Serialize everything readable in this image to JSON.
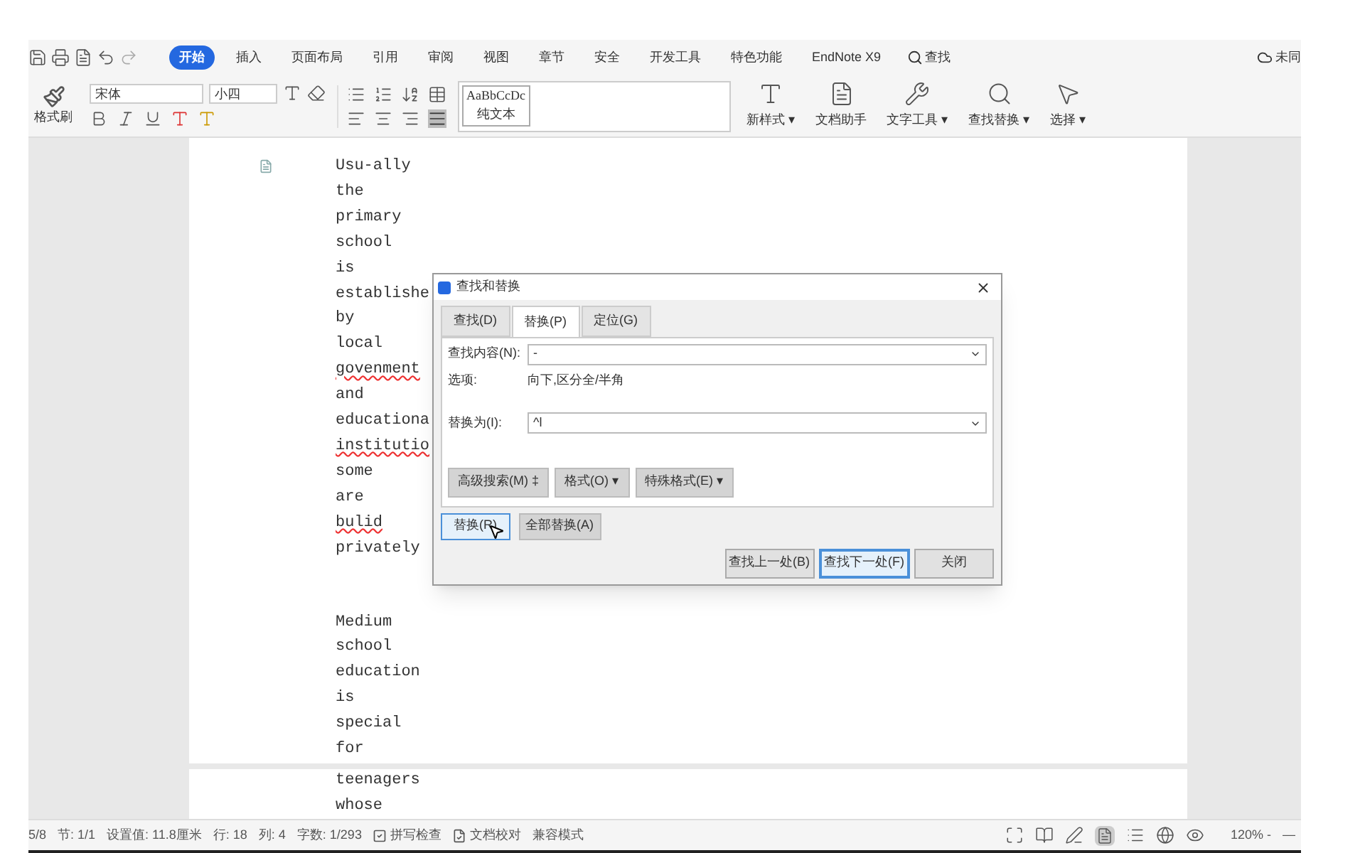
{
  "ribbon": {
    "tabs": [
      {
        "label": "开始",
        "selected": true
      },
      {
        "label": "插入",
        "selected": false
      },
      {
        "label": "页面布局",
        "selected": false
      },
      {
        "label": "引用",
        "selected": false
      },
      {
        "label": "审阅",
        "selected": false
      },
      {
        "label": "视图",
        "selected": false
      },
      {
        "label": "章节",
        "selected": false
      },
      {
        "label": "安全",
        "selected": false
      },
      {
        "label": "开发工具",
        "selected": false
      },
      {
        "label": "特色功能",
        "selected": false
      },
      {
        "label": "EndNote X9",
        "selected": false
      }
    ],
    "search_label": "查找",
    "sync_label": "未同",
    "format_painter": "格式刷",
    "font_name": "宋体",
    "font_size": "小四",
    "style_gallery": [
      {
        "preview": "AaBbCcDc",
        "label": "纯文本"
      }
    ],
    "big_buttons": [
      {
        "kind": "styles",
        "label": "新样式 ▾"
      },
      {
        "kind": "doc",
        "label": "文档助手"
      },
      {
        "kind": "tools",
        "label": "文字工具 ▾"
      },
      {
        "kind": "find",
        "label": "查找替换 ▾"
      },
      {
        "kind": "select",
        "label": "选择 ▾"
      }
    ]
  },
  "document": {
    "page1": [
      {
        "text": "Usu-ally",
        "misspelled": false
      },
      {
        "text": "the",
        "misspelled": false
      },
      {
        "text": "primary",
        "misspelled": false
      },
      {
        "text": "school",
        "misspelled": false
      },
      {
        "text": "is",
        "misspelled": false
      },
      {
        "text": "establishe",
        "misspelled": false
      },
      {
        "text": "by",
        "misspelled": false
      },
      {
        "text": "local",
        "misspelled": false
      },
      {
        "text": "govenment",
        "misspelled": true
      },
      {
        "text": "and",
        "misspelled": false
      },
      {
        "text": "educationa",
        "misspelled": false
      },
      {
        "text": "institutio",
        "misspelled": true
      },
      {
        "text": "some",
        "misspelled": false
      },
      {
        "text": "are",
        "misspelled": false
      },
      {
        "text": "bulid",
        "misspelled": true
      },
      {
        "text": "privately",
        "misspelled": false
      }
    ],
    "page1_paragraph2": [
      {
        "text": "Medium",
        "misspelled": false
      },
      {
        "text": "school",
        "misspelled": false
      },
      {
        "text": "education",
        "misspelled": false
      },
      {
        "text": "is",
        "misspelled": false
      },
      {
        "text": "special",
        "misspelled": false
      },
      {
        "text": "for",
        "misspelled": false
      }
    ],
    "page2": [
      {
        "text": "teenagers",
        "misspelled": false
      },
      {
        "text": "whose",
        "misspelled": false
      }
    ]
  },
  "dialog": {
    "title": "查找和替换",
    "tabs": [
      {
        "label": "查找(D)",
        "selected": false
      },
      {
        "label": "替换(P)",
        "selected": true
      },
      {
        "label": "定位(G)",
        "selected": false
      }
    ],
    "find_label": "查找内容(N):",
    "find_value": "-",
    "options_label": "选项:",
    "options_value": "向下,区分全/半角",
    "replace_label": "替换为(I):",
    "replace_value": "^l",
    "option_buttons": [
      "高级搜索(M) ‡",
      "格式(O) ▾",
      "特殊格式(E) ▾"
    ],
    "action_buttons": [
      {
        "label": "替换(R)",
        "focused": true
      },
      {
        "label": "全部替换(A)",
        "focused": false
      }
    ],
    "footer_buttons": [
      {
        "label": "查找上一处(B)",
        "focused": false
      },
      {
        "label": "查找下一处(F)",
        "focused": true
      },
      {
        "label": "关闭",
        "focused": false
      }
    ]
  },
  "status_bar": {
    "items": [
      "5/8",
      "节: 1/1",
      "设置值: 11.8厘米",
      "行: 18",
      "列: 4",
      "字数: 1/293"
    ],
    "toggles": [
      {
        "kind": "check",
        "label": "拼写检查"
      },
      {
        "kind": "proof",
        "label": "文档校对"
      }
    ],
    "mode": "兼容模式",
    "views": [
      {
        "kind": "fullscreen",
        "selected": false
      },
      {
        "kind": "read",
        "selected": false
      },
      {
        "kind": "pen",
        "selected": false
      },
      {
        "kind": "page",
        "selected": true
      },
      {
        "kind": "outline",
        "selected": false
      },
      {
        "kind": "web",
        "selected": false
      },
      {
        "kind": "eye",
        "selected": false
      }
    ],
    "zoom": "120% -",
    "zoom_minus": "—"
  }
}
